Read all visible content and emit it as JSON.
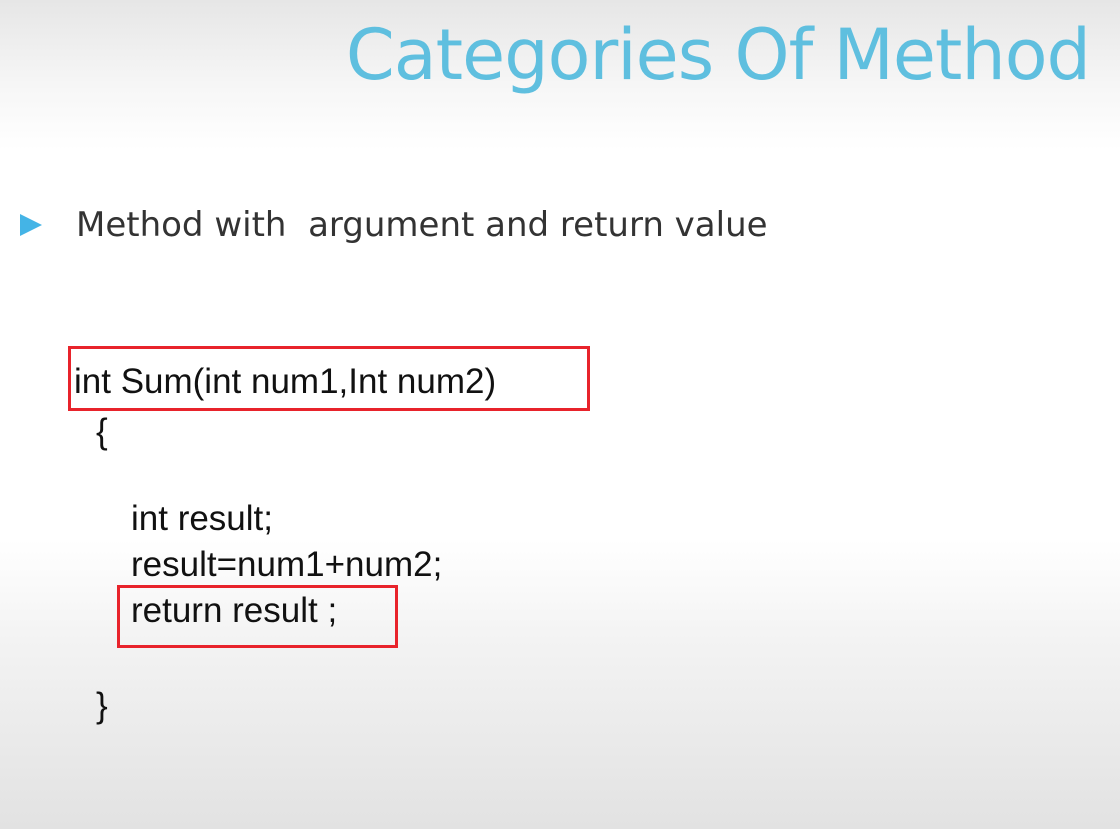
{
  "slide": {
    "title": "Categories Of Method",
    "bullet": {
      "icon": "triangle-bullet-icon",
      "text": "Method with  argument and return value",
      "color": "#44b4e6"
    },
    "code": {
      "signature": "int Sum(int num1,Int num2)",
      "open_brace": "{",
      "line_declare": "int result;",
      "line_assign": "result=num1+num2;",
      "line_return": "return result ;",
      "close_brace": "}"
    },
    "colors": {
      "title": "#5fbfdf",
      "highlight_box": "#e8232b"
    }
  }
}
